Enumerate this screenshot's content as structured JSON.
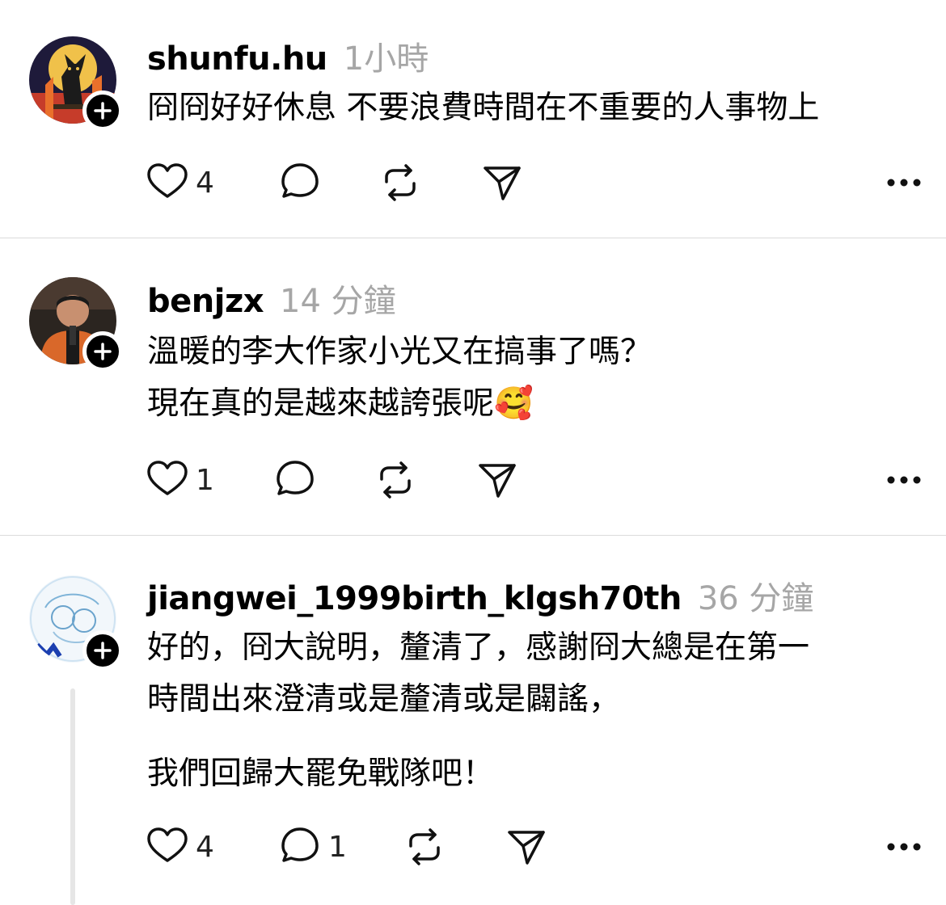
{
  "posts": [
    {
      "username": "shunfu.hu",
      "time": "1小時",
      "lines": [
        "冏冏好好休息 不要浪費時間在不重要的人事物上"
      ],
      "likes": "4",
      "replies": ""
    },
    {
      "username": "benjzx",
      "time": "14 分鐘",
      "lines": [
        "溫暖的李大作家小光又在搞事了嗎？",
        "現在真的是越來越誇張呢🥰"
      ],
      "likes": "1",
      "replies": ""
    },
    {
      "username": "jiangwei_1999birth_klgsh70th",
      "time": "36 分鐘",
      "lines": [
        "好的，冏大說明，釐清了，感謝冏大總是在第一",
        "時間出來澄清或是釐清或是闢謠，",
        "我們回歸大罷免戰隊吧！"
      ],
      "likes": "4",
      "replies": "1"
    }
  ],
  "icons": {
    "like": "heart-icon",
    "reply": "comment-bubble-icon",
    "repost": "repost-icon",
    "share": "send-icon",
    "more": "more-dots-icon",
    "follow": "plus-icon"
  }
}
